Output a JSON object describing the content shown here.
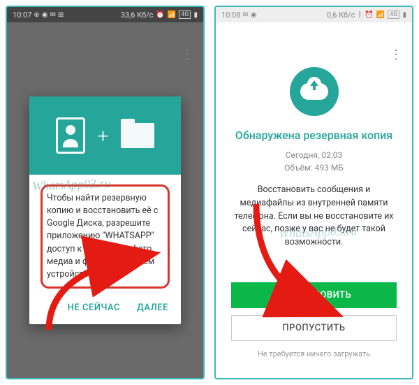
{
  "phone1": {
    "status": {
      "time": "10:07",
      "speed": "33,6 Кб/с",
      "net": "4G"
    },
    "dialog": {
      "text": "Чтобы найти резервную копию и восстановить её с Google Диска, разрешите приложению \"WHATSAPP\" доступ к контактам, фото, медиа и файлам на своём устройстве.",
      "not_now": "НЕ СЕЙЧАС",
      "next": "ДАЛЕЕ"
    },
    "watermark": "WhatsApp03.ru"
  },
  "phone2": {
    "status": {
      "time": "10:08",
      "speed": "0,6 Кб/с",
      "net": "4G"
    },
    "title": "Обнаружена резервная копия",
    "meta_line1": "Сегодня, 02:03",
    "meta_line2": "Объём: 493 МБ",
    "description": "Восстановить сообщения и медиафайлы из внутренней памяти телефона. Если вы не восстановите их сейчас, позже у вас не будет такой возможности.",
    "restore": "ВОССТАНОВИТЬ",
    "skip": "ПРОПУСТИТЬ",
    "footnote": "Не требуется ничего загружать",
    "watermark": "WhatsApp03.ru"
  }
}
